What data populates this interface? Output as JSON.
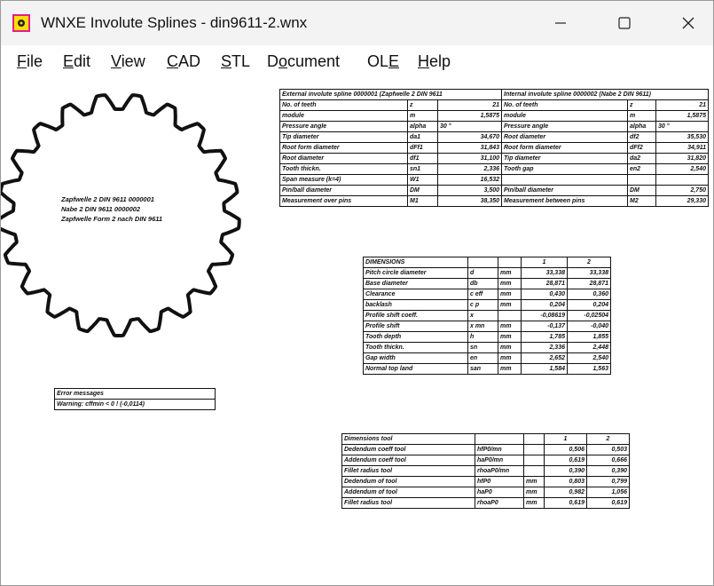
{
  "app": {
    "title": "WNXE  Involute Splines  -  din9611-2.wnx",
    "icon": "wnxe-app-icon",
    "accent": "#ffde00",
    "icon_border": "#e0208a"
  },
  "menu": [
    {
      "label": "File",
      "mnemonic": "F",
      "rest": "ile"
    },
    {
      "label": "Edit",
      "mnemonic": "E",
      "rest": "dit"
    },
    {
      "label": "View",
      "mnemonic": "V",
      "rest": "iew"
    },
    {
      "label": "CAD",
      "mnemonic": "C",
      "rest": "AD"
    },
    {
      "label": "STL",
      "mnemonic": "S",
      "rest": "TL"
    },
    {
      "label": "Document",
      "mnemonic": "",
      "pre": "D",
      "mid": "o",
      "rest": "cument"
    },
    {
      "label": "OLE",
      "mnemonic": "",
      "pre": "OL",
      "mid": "E",
      "rest": ""
    },
    {
      "label": "Help",
      "mnemonic": "H",
      "rest": "elp"
    }
  ],
  "gear": {
    "teeth": 21,
    "labels": [
      "Zapfwelle 2 DIN 9611 0000001",
      "Nabe 2 DIN 9611 0000002",
      "Zapfwelle Form 2 nach DIN 9611"
    ]
  },
  "external_spline": {
    "header": "External involute spline 0000001 (Zapfwelle 2 DIN 9611",
    "rows": [
      [
        "No. of teeth",
        "z",
        "21"
      ],
      [
        "module",
        "m",
        "1,5875"
      ],
      [
        "Pressure angle",
        "alpha",
        "30 °"
      ],
      [
        "Tip diameter",
        "da1",
        "34,670"
      ],
      [
        "Root form diameter",
        "dFf1",
        "31,843"
      ],
      [
        "Root diameter",
        "df1",
        "31,100"
      ],
      [
        "Tooth thickn.",
        "sn1",
        "2,336"
      ],
      [
        "Span measure (k=4)",
        "W1",
        "16,532"
      ],
      [
        "Pin/ball diameter",
        "DM",
        "3,500"
      ],
      [
        "Measurement over pins",
        "M1",
        "38,350"
      ]
    ]
  },
  "internal_spline": {
    "header": "Internal involute spline 0000002 (Nabe 2 DIN 9611)",
    "rows": [
      [
        "No. of teeth",
        "z",
        "21"
      ],
      [
        "module",
        "m",
        "1,5875"
      ],
      [
        "Pressure angle",
        "alpha",
        "30 °"
      ],
      [
        "Root diameter",
        "df2",
        "35,530"
      ],
      [
        "Root form diameter",
        "dFf2",
        "34,911"
      ],
      [
        "Tip diameter",
        "da2",
        "31,820"
      ],
      [
        "Tooth gap",
        "en2",
        "2,540"
      ],
      [
        "",
        "",
        ""
      ],
      [
        "Pin/ball diameter",
        "DM",
        "2,750"
      ],
      [
        "Measurement between pins",
        "M2",
        "29,330"
      ]
    ]
  },
  "dimensions": {
    "header": [
      "DIMENSIONS",
      "",
      "",
      "1",
      "2"
    ],
    "rows": [
      [
        "Pitch circle diameter",
        "d",
        "mm",
        "33,338",
        "33,338"
      ],
      [
        "Base diameter",
        "db",
        "mm",
        "28,871",
        "28,871"
      ],
      [
        "Clearance",
        "c eff",
        "mm",
        "0,430",
        "0,360"
      ],
      [
        "backlash",
        "c p",
        "mm",
        "0,204",
        "0,204"
      ],
      [
        "Profile shift coeff.",
        "x",
        "",
        "-0,08619",
        "-0,02504"
      ],
      [
        "Profile shift",
        "x mn",
        "mm",
        "-0,137",
        "-0,040"
      ],
      [
        "Tooth depth",
        "h",
        "mm",
        "1,785",
        "1,855"
      ],
      [
        "Tooth thickn.",
        "sn",
        "mm",
        "2,336",
        "2,448"
      ],
      [
        "Gap width",
        "en",
        "mm",
        "2,652",
        "2,540"
      ],
      [
        "Normal top land",
        "san",
        "mm",
        "1,584",
        "1,563"
      ]
    ]
  },
  "errors": {
    "header": "Error messages",
    "message": "Warning: cffmin < 0 ! (-0,0114)"
  },
  "tool": {
    "header": [
      "Dimensions tool",
      "",
      "",
      "1",
      "2"
    ],
    "rows": [
      [
        "Dedendum coeff tool",
        "hfP0/mn",
        "",
        "0,506",
        "0,503"
      ],
      [
        "Addendum coeff tool",
        "haP0/mn",
        "",
        "0,619",
        "0,666"
      ],
      [
        "Fillet radius tool",
        "rhoaP0/mn",
        "",
        "0,390",
        "0,390"
      ],
      [
        "Dedendum of tool",
        "hfP0",
        "mm",
        "0,803",
        "0,799"
      ],
      [
        "Addendum of tool",
        "haP0",
        "mm",
        "0,982",
        "1,056"
      ],
      [
        "Fillet radius tool",
        "rhoaP0",
        "mm",
        "0,619",
        "0,619"
      ]
    ]
  }
}
